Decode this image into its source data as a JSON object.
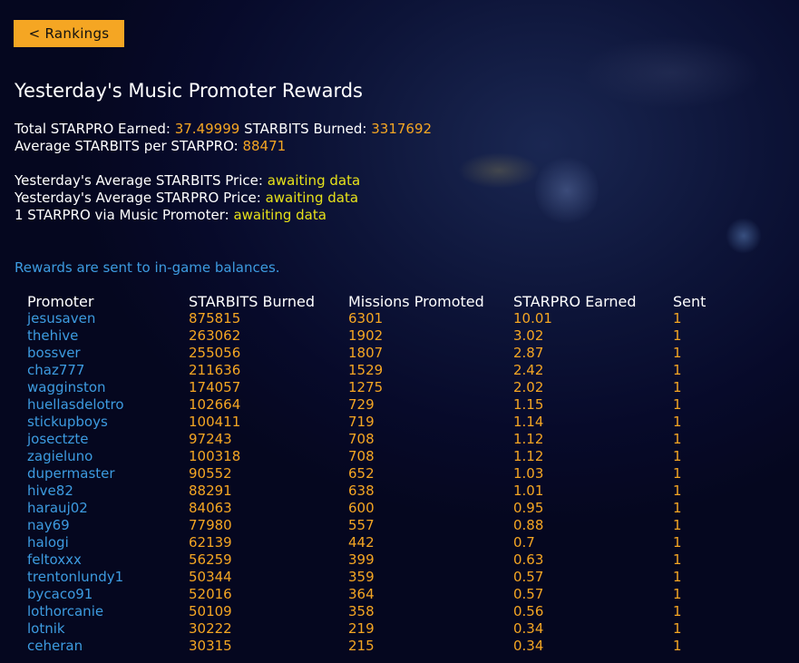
{
  "back_button": "< Rankings",
  "title": "Yesterday's Music Promoter Rewards",
  "stats": {
    "total_label": "Total STARPRO Earned:",
    "total_value": "37.49999",
    "burned_label": "STARBITS Burned:",
    "burned_value": "3317692",
    "average_label": "Average STARBITS per STARPRO:",
    "average_value": "88471"
  },
  "prices": {
    "starbits_label": "Yesterday's Average STARBITS Price:",
    "starbits_value": "awaiting data",
    "starpro_label": "Yesterday's Average STARPRO Price:",
    "starpro_value": "awaiting data",
    "via_label": "1 STARPRO via Music Promoter:",
    "via_value": "awaiting data"
  },
  "note": "Rewards are sent to in-game balances.",
  "table": {
    "headers": [
      "Promoter",
      "STARBITS Burned",
      "Missions Promoted",
      "STARPRO Earned",
      "Sent"
    ],
    "rows": [
      [
        "jesusaven",
        "875815",
        "6301",
        "10.01",
        "1"
      ],
      [
        "thehive",
        "263062",
        "1902",
        "3.02",
        "1"
      ],
      [
        "bossver",
        "255056",
        "1807",
        "2.87",
        "1"
      ],
      [
        "chaz777",
        "211636",
        "1529",
        "2.42",
        "1"
      ],
      [
        "wagginston",
        "174057",
        "1275",
        "2.02",
        "1"
      ],
      [
        "huellasdelotro",
        "102664",
        "729",
        "1.15",
        "1"
      ],
      [
        "stickupboys",
        "100411",
        "719",
        "1.14",
        "1"
      ],
      [
        "josectzte",
        "97243",
        "708",
        "1.12",
        "1"
      ],
      [
        "zagieluno",
        "100318",
        "708",
        "1.12",
        "1"
      ],
      [
        "dupermaster",
        "90552",
        "652",
        "1.03",
        "1"
      ],
      [
        "hive82",
        "88291",
        "638",
        "1.01",
        "1"
      ],
      [
        "harauj02",
        "84063",
        "600",
        "0.95",
        "1"
      ],
      [
        "nay69",
        "77980",
        "557",
        "0.88",
        "1"
      ],
      [
        "halogi",
        "62139",
        "442",
        "0.7",
        "1"
      ],
      [
        "feltoxxx",
        "56259",
        "399",
        "0.63",
        "1"
      ],
      [
        "trentonlundy1",
        "50344",
        "359",
        "0.57",
        "1"
      ],
      [
        "bycaco91",
        "52016",
        "364",
        "0.57",
        "1"
      ],
      [
        "lothorcanie",
        "50109",
        "358",
        "0.56",
        "1"
      ],
      [
        "lotnik",
        "30222",
        "219",
        "0.34",
        "1"
      ],
      [
        "ceheran",
        "30315",
        "215",
        "0.34",
        "1"
      ]
    ]
  },
  "colors": {
    "accent": "#f5a623",
    "link": "#3d9be0",
    "highlight": "#e7e21a",
    "background": "#070a2a"
  }
}
